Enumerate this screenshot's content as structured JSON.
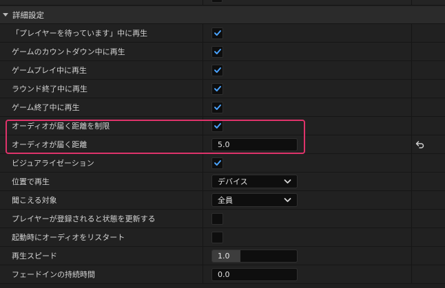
{
  "section": {
    "title": "詳細設定"
  },
  "rows": [
    {
      "label": "「プレイヤーを待っています」中に再生",
      "type": "checkbox",
      "checked": true
    },
    {
      "label": "ゲームのカウントダウン中に再生",
      "type": "checkbox",
      "checked": true
    },
    {
      "label": "ゲームプレイ中に再生",
      "type": "checkbox",
      "checked": true
    },
    {
      "label": "ラウンド終了中に再生",
      "type": "checkbox",
      "checked": true
    },
    {
      "label": "ゲーム終了中に再生",
      "type": "checkbox",
      "checked": true
    },
    {
      "label": "オーディオが届く距離を制限",
      "type": "checkbox",
      "checked": true
    },
    {
      "label": "オーディオが届く距離",
      "type": "text",
      "value": "5.0",
      "reset": "reset-arrow-icon"
    },
    {
      "label": "ビジュアライゼーション",
      "type": "checkbox",
      "checked": true
    },
    {
      "label": "位置で再生",
      "type": "dropdown",
      "value": "デバイス"
    },
    {
      "label": "聞こえる対象",
      "type": "dropdown",
      "value": "全員"
    },
    {
      "label": "プレイヤーが登録されると状態を更新する",
      "type": "checkbox",
      "checked": false
    },
    {
      "label": "起動時にオーディオをリスタート",
      "type": "checkbox",
      "checked": false
    },
    {
      "label": "再生スピード",
      "type": "slider",
      "value": "1.0",
      "fill": 0.33
    },
    {
      "label": "フェードインの持続時間",
      "type": "text",
      "value": "0.0"
    }
  ],
  "colors": {
    "accent": "#4aa3ff",
    "highlight": "#e0336b"
  }
}
